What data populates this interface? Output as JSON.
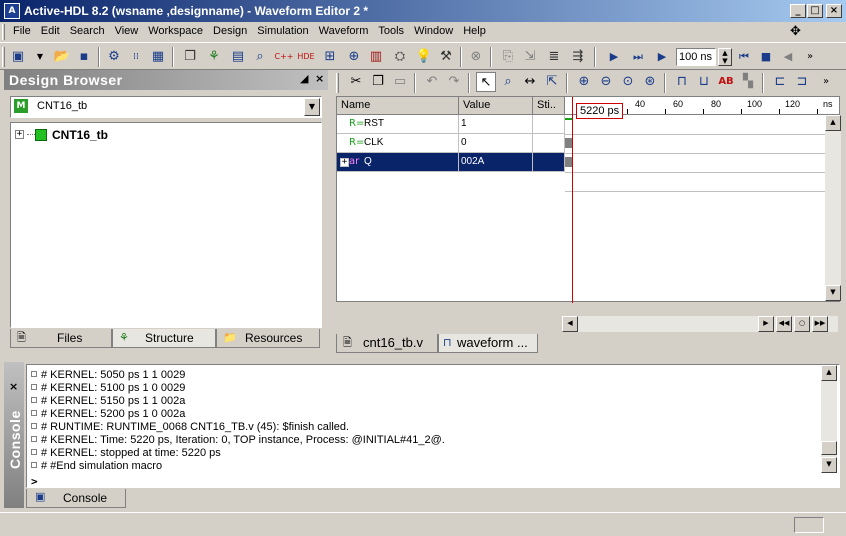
{
  "window": {
    "title": "Active-HDL 8.2 (wsname ,designname) - Waveform Editor 2 *",
    "app_icon_text": "A",
    "controls": {
      "minimize": "_",
      "maximize": "□",
      "close": "×"
    }
  },
  "menu": {
    "items": [
      "File",
      "Edit",
      "Search",
      "View",
      "Workspace",
      "Design",
      "Simulation",
      "Waveform",
      "Tools",
      "Window",
      "Help"
    ]
  },
  "toolbar": {
    "sim_time": "100 ns"
  },
  "design_browser": {
    "title": "Design Browser",
    "combo_value": "CNT16_tb",
    "combo_icon_text": "M",
    "tree_root": "CNT16_tb",
    "tabs": [
      "Files",
      "Structure",
      "Resources"
    ]
  },
  "waveform": {
    "columns": {
      "name": "Name",
      "value": "Value",
      "stimulus": "Sti.."
    },
    "signals": [
      {
        "name": "RST",
        "value": "1",
        "icon": "R="
      },
      {
        "name": "CLK",
        "value": "0",
        "icon": "R="
      },
      {
        "name": "Q",
        "value": "002A",
        "icon": "ar"
      }
    ],
    "ruler_ticks": [
      "40",
      "60",
      "80",
      "100",
      "120"
    ],
    "ruler_unit": "ns",
    "cursor_label": "5220 ps",
    "tabs": [
      "cnt16_tb.v",
      "waveform ..."
    ]
  },
  "console": {
    "title": "Console",
    "lines": [
      "# KERNEL: 5050 ps 1 1 0029",
      "# KERNEL: 5100 ps 1 0 0029",
      "# KERNEL: 5150 ps 1 1 002a",
      "# KERNEL: 5200 ps 1 0 002a",
      "# RUNTIME: RUNTIME_0068 CNT16_TB.v (45): $finish called.",
      "# KERNEL: Time: 5220 ps,  Iteration: 0,  TOP instance,  Process: @INITIAL#41_2@.",
      "# KERNEL: stopped at time: 5220 ps",
      "# #End simulation macro"
    ],
    "prompt": ">",
    "tab": "Console"
  }
}
